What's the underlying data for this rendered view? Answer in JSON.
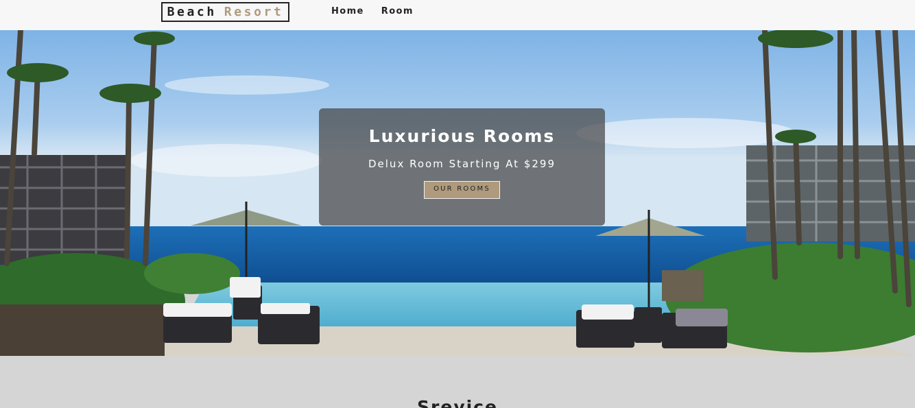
{
  "navbar": {
    "logo_word1": "Beach",
    "logo_word2": "Resort",
    "links": [
      "Home",
      "Room"
    ]
  },
  "hero": {
    "title": "Luxurious Rooms",
    "subtitle": "Delux Room Starting At $299",
    "button_label": "OUR ROOMS"
  },
  "services": {
    "title": "Srevice"
  },
  "colors": {
    "navbar_bg": "#f7f7f7",
    "accent": "#af9a7d",
    "services_bg": "#d5d5d5",
    "text_dark": "#222222"
  }
}
